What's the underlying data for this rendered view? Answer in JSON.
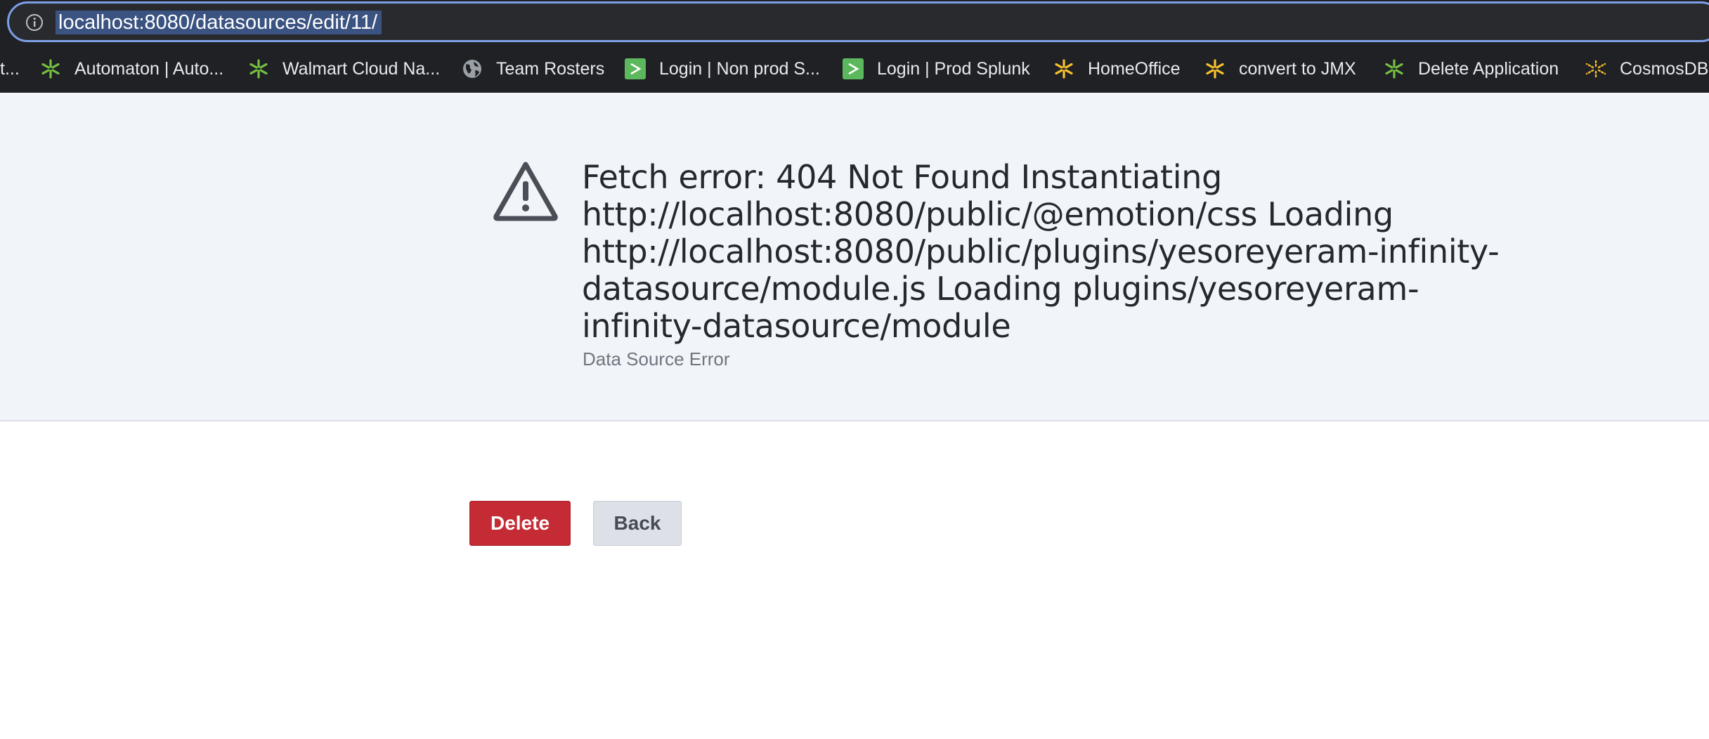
{
  "browser": {
    "url": "localhost:8080/datasources/edit/11/",
    "bookmarks": [
      {
        "label": "t...",
        "icon": "bookmark-icon"
      },
      {
        "label": "Automaton | Auto...",
        "icon": "walmart-spark-icon"
      },
      {
        "label": "Walmart Cloud Na...",
        "icon": "walmart-spark-icon"
      },
      {
        "label": "Team Rosters",
        "icon": "globe-icon"
      },
      {
        "label": "Login | Non prod S...",
        "icon": "splunk-icon"
      },
      {
        "label": "Login | Prod Splunk",
        "icon": "splunk-icon"
      },
      {
        "label": "HomeOffice",
        "icon": "walmart-spark-icon"
      },
      {
        "label": "convert to JMX",
        "icon": "walmart-spark-icon"
      },
      {
        "label": "Delete Application",
        "icon": "walmart-spark-icon"
      },
      {
        "label": "CosmosDB",
        "icon": "dotted-spark-icon"
      }
    ],
    "colors": {
      "spark_green": "#76c043",
      "spark_yellow": "#f9c22e",
      "splunk_green": "#5cb85c"
    }
  },
  "error": {
    "title": "Fetch error: 404 Not Found Instantiating http://localhost:8080/public/@emotion/css Loading http://localhost:8080/public/plugins/yesoreyeram-infinity-datasource/module.js Loading plugins/yesoreyeram-infinity-datasource/module",
    "subtitle": "Data Source Error",
    "icon": "warning-triangle-icon"
  },
  "actions": {
    "delete_label": "Delete",
    "back_label": "Back",
    "delete_color": "#c42b34"
  }
}
